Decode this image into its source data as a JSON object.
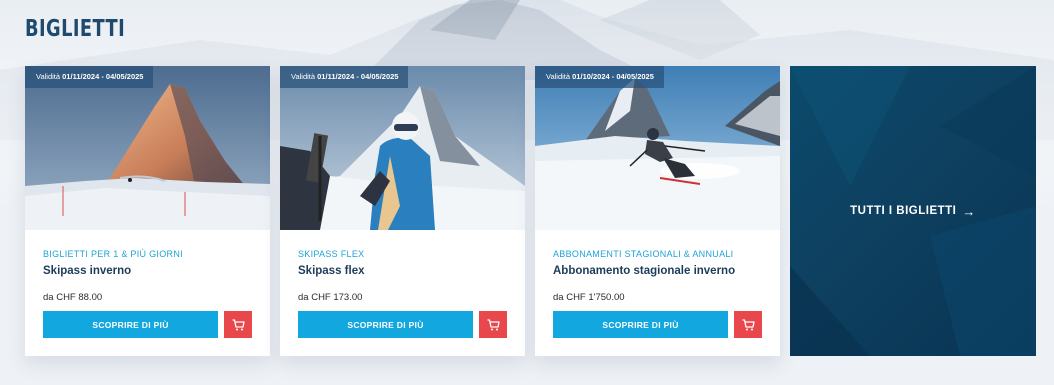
{
  "page": {
    "title": "BIGLIETTI"
  },
  "cards": [
    {
      "validity_prefix": "Validità",
      "validity_dates": "01/11/2024 - 04/05/2025",
      "category": "BIGLIETTI PER 1 & PIÙ GIORNI",
      "title": "Skipass inverno",
      "price": "da CHF 88.00",
      "button": "SCOPRIRE DI PIÙ",
      "cart_icon": "cart-icon",
      "image": "sunlit-matterhorn-skier"
    },
    {
      "validity_prefix": "Validità",
      "validity_dates": "01/11/2024 - 04/05/2025",
      "category": "SKIPASS FLEX",
      "title": "Skipass flex",
      "price": "da CHF 173.00",
      "button": "SCOPRIRE DI PIÙ",
      "cart_icon": "cart-icon",
      "image": "skier-helmet-matterhorn"
    },
    {
      "validity_prefix": "Validità",
      "validity_dates": "01/10/2024 - 04/05/2025",
      "category": "ABBONAMENTI STAGIONALI & ANNUALI",
      "title": "Abbonamento stagionale inverno",
      "price": "da CHF 1'750.00",
      "button": "SCOPRIRE DI PIÙ",
      "cart_icon": "cart-icon",
      "image": "carving-skier-matterhorn"
    }
  ],
  "all_tickets": {
    "label": "TUTTI I BIGLIETTI",
    "arrow_icon": "arrow-right-icon"
  },
  "colors": {
    "title": "#1f4a6e",
    "category": "#1ea3d6",
    "button": "#12a7df",
    "cart": "#e8474c",
    "all_card": "#0e3f5f"
  }
}
